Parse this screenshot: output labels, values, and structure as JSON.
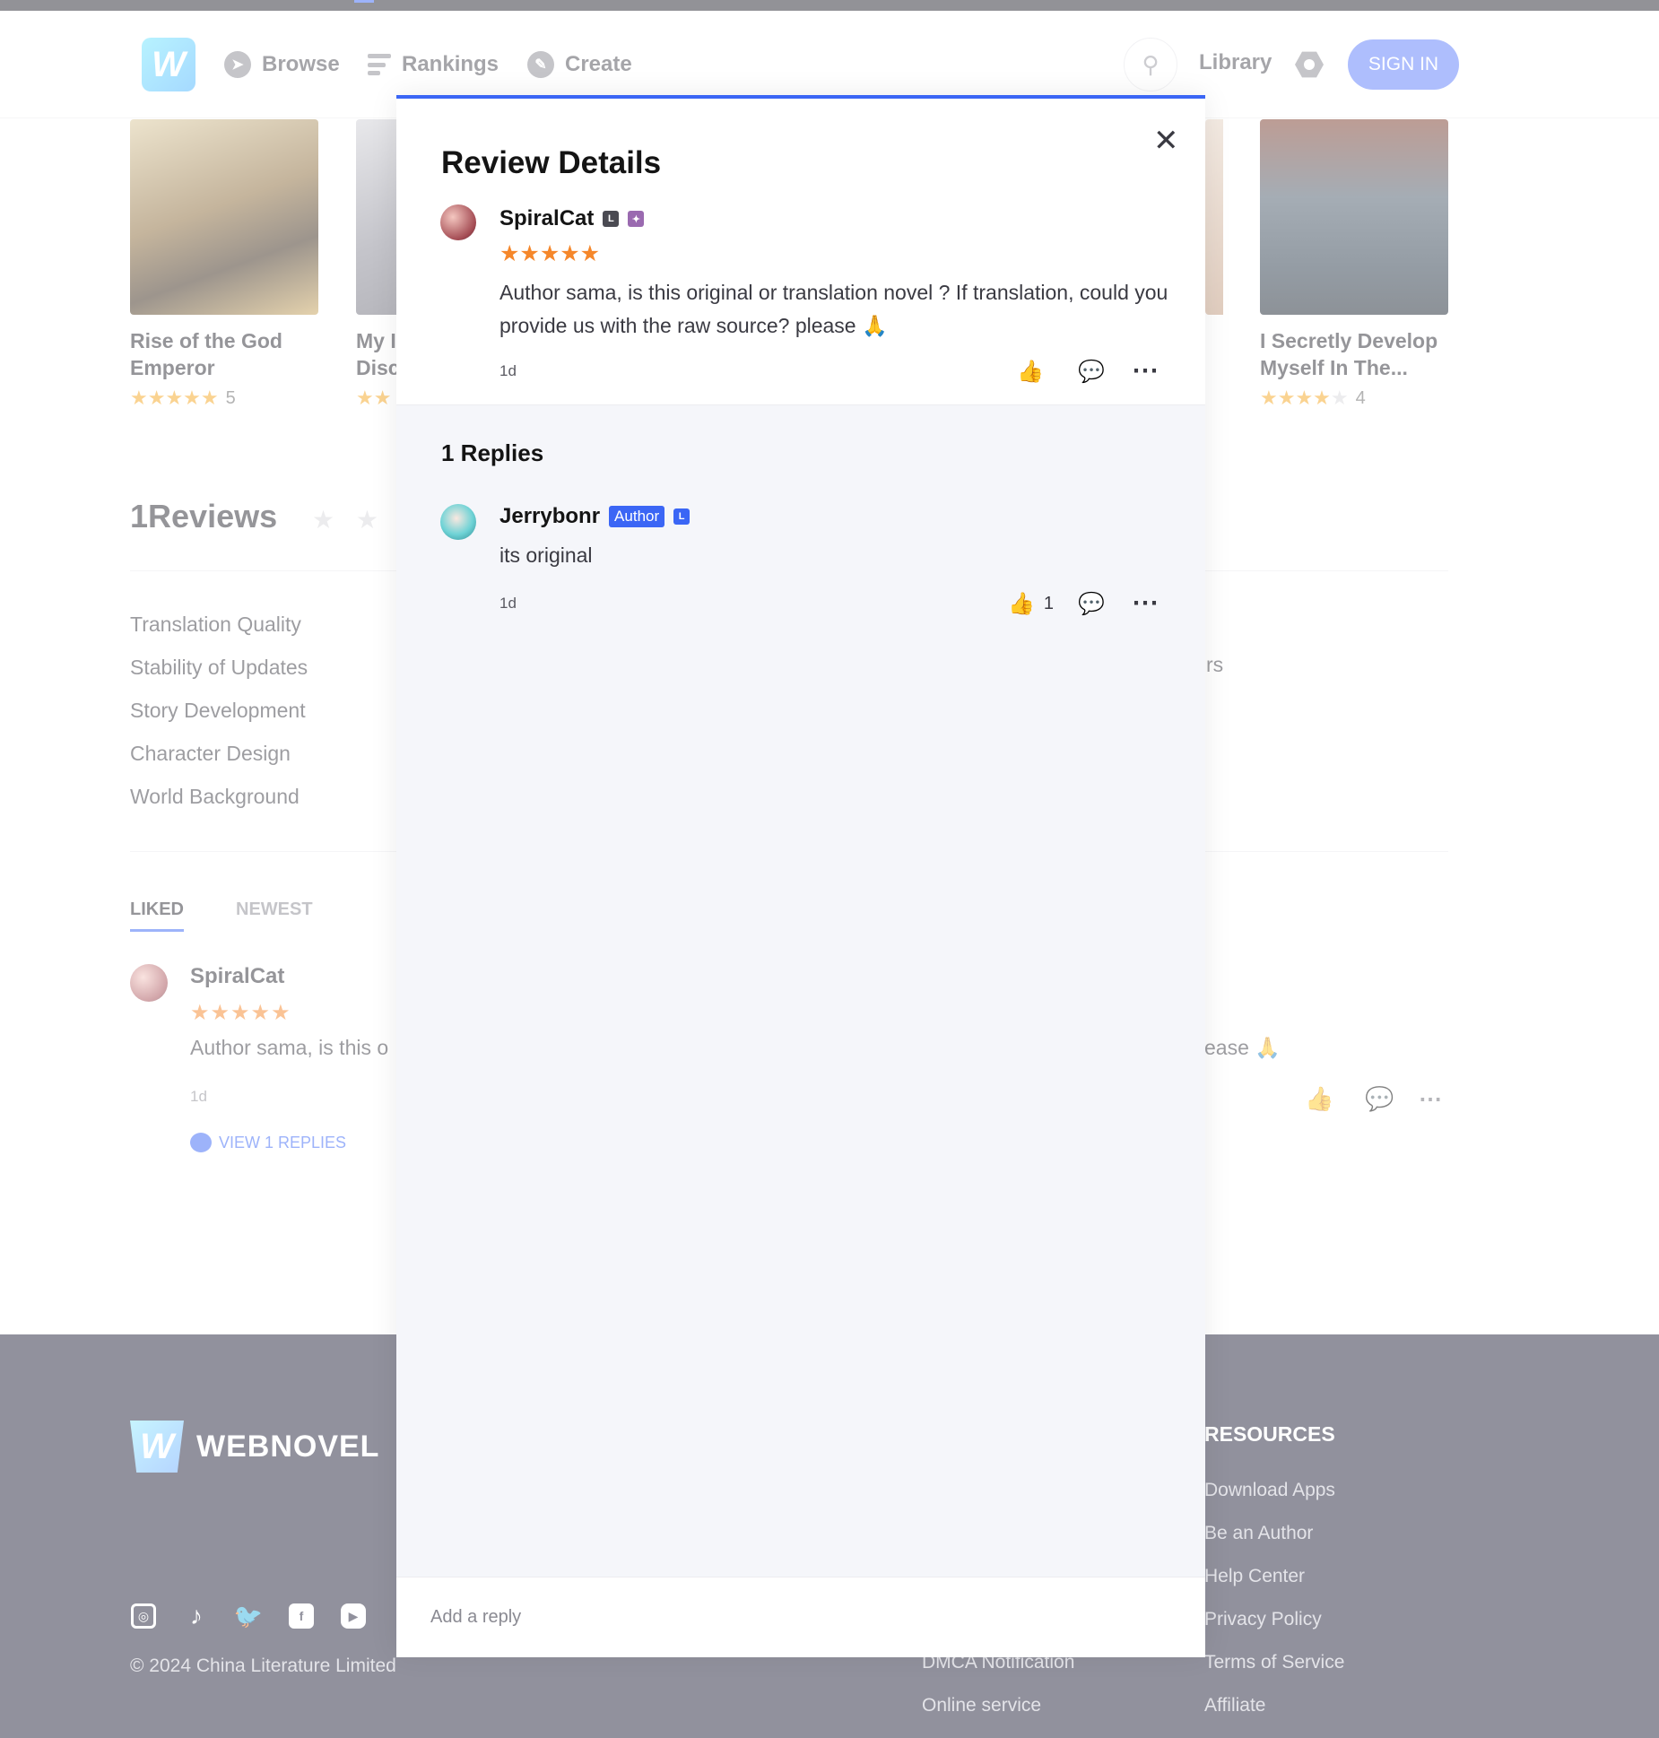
{
  "header": {
    "logo_letter": "W",
    "nav": [
      {
        "label": "Browse",
        "icon": "compass-icon"
      },
      {
        "label": "Rankings",
        "icon": "bars-icon"
      },
      {
        "label": "Create",
        "icon": "pen-icon"
      }
    ],
    "library_label": "Library",
    "signin_label": "SIGN IN"
  },
  "books": [
    {
      "title_line1": "Rise of the God",
      "title_line2": "Emperor",
      "stars": "★★★★★",
      "rating": "5"
    },
    {
      "title_line1": "My I",
      "title_line2": "Disc",
      "stars": "★★",
      "rating": ""
    },
    {
      "title_line1": "I Secretly Develop",
      "title_line2": "Myself In The...",
      "stars": "★★★★",
      "empty_stars": "★",
      "rating": "4"
    }
  ],
  "reviews": {
    "title": "1Reviews",
    "stars": "★ ★ ★",
    "criteria": [
      "Translation Quality",
      "Stability of Updates",
      "Story Development",
      "Character Design",
      "World Background"
    ],
    "right_fragment": "rs",
    "tabs": [
      "LIKED",
      "NEWEST"
    ],
    "item": {
      "username": "SpiralCat",
      "stars": "★★★★★",
      "text_left": "Author sama, is this o",
      "text_right": "ease 🙏",
      "time": "1d",
      "view_replies": "VIEW 1 REPLIES"
    }
  },
  "footer": {
    "brand": "WEBNOVEL",
    "resources_heading": "RESOURCES",
    "resources": [
      "Download Apps",
      "Be an Author",
      "Help Center",
      "Privacy Policy",
      "Terms of Service",
      "Affiliate"
    ],
    "mid_links": [
      "DMCA Notification",
      "Online service"
    ],
    "copyright": "© 2024 China Literature Limited"
  },
  "modal": {
    "title": "Review Details",
    "close_symbol": "✕",
    "review": {
      "username": "SpiralCat",
      "stars": "★★★★★",
      "text": "Author sama, is this original or translation novel ? If translation, could you provide us with the raw source? please 🙏",
      "time": "1d"
    },
    "replies_heading": "1 Replies",
    "reply": {
      "username": "Jerrybonr",
      "badge": "Author",
      "text": "its original",
      "time": "1d",
      "like_count": "1"
    },
    "reply_placeholder": "Add a reply"
  },
  "colors": {
    "accent": "#3b66f5",
    "star": "#f5872b",
    "footer_bg": "#23233a"
  }
}
